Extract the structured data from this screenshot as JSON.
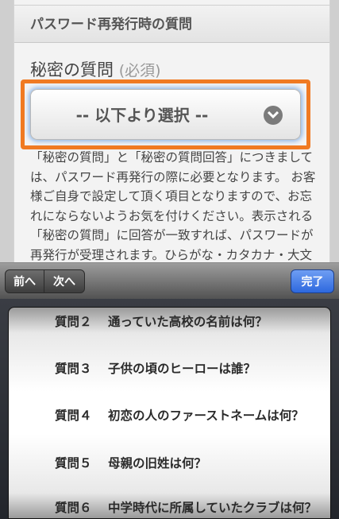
{
  "page": {
    "section_header": "パスワード再発行時の質問",
    "question_label": "秘密の質問",
    "question_required": "(必須)",
    "select_text": "-- 以下より選択 --",
    "description": "「秘密の質問」と「秘密の質問回答」につきましては、パスワード再発行の際に必要となります。 お客様ご自身で設定して頂く項目となりますので、お忘れにならないようお気を付けください。表示される「秘密の質問」に回答が一致すれば、パスワードが再発行が受理されます。ひらがな・カタカナ・大文字・小文字・半角・全角で区別されます。"
  },
  "toolbar": {
    "prev_label": "前へ",
    "next_label": "次へ",
    "done_label": "完了"
  },
  "picker": {
    "options": [
      {
        "num": "質問２",
        "text": "通っていた高校の名前は何？"
      },
      {
        "num": "質問３",
        "text": "子供の頃のヒーローは誰？"
      },
      {
        "num": "質問４",
        "text": "初恋の人のファーストネームは何？"
      },
      {
        "num": "質問５",
        "text": "母親の旧姓は何？"
      },
      {
        "num": "質問６",
        "text": "中学時代に所属していたクラブは何？"
      }
    ]
  },
  "colors": {
    "highlight_border": "#f07a22",
    "done_button": "#2d68de"
  }
}
